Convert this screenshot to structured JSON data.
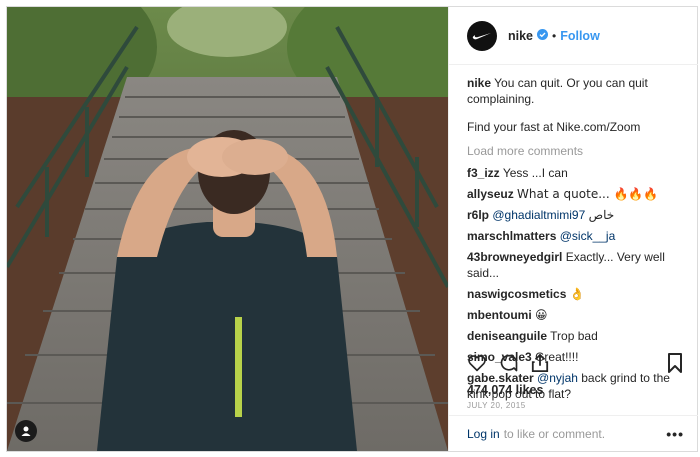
{
  "post": {
    "username": "nike",
    "follow_label": "Follow",
    "dot": "•",
    "caption_user": "nike",
    "caption_text": "You can quit. Or you can quit complaining.",
    "caption_extra": "Find your fast at Nike.com/Zoom",
    "load_more": "Load more comments",
    "comments": [
      {
        "user": "f3_izz",
        "text": "Yess ...I can",
        "mention": ""
      },
      {
        "user": "allyseuz",
        "text": "What a quote... 🔥🔥🔥",
        "mention": ""
      },
      {
        "user": "r6lp",
        "mention": "@ghadialtmimi97",
        "text": " خاص"
      },
      {
        "user": "marschlmatters",
        "mention": "@sick__ja",
        "text": ""
      },
      {
        "user": "43browneyedgirl",
        "text": "Exactly... Very well said...",
        "mention": ""
      },
      {
        "user": "naswigcosmetics",
        "text": "👌",
        "mention": ""
      },
      {
        "user": "mbentoumi",
        "text": "😀",
        "mention": ""
      },
      {
        "user": "deniseanguile",
        "text": "Trop bad",
        "mention": ""
      },
      {
        "user": "simo_vale3",
        "text": "Great!!!!",
        "mention": ""
      },
      {
        "user": "gabe.skater",
        "mention": "@nyjah",
        "text": " back grind to the kink pop out to flat?"
      }
    ],
    "likes": "474,074 likes",
    "date": "JULY 20, 2015",
    "login_label": "Log in",
    "login_suffix": "to like or comment.",
    "more_label": "•••"
  },
  "icons": {
    "avatar": "nike-swoosh-icon",
    "verified": "verified-badge-icon",
    "like": "heart-icon",
    "comment": "comment-bubble-icon",
    "share": "share-icon",
    "save": "bookmark-icon",
    "user_tag": "user-tag-icon"
  },
  "colors": {
    "link": "#3897f0",
    "mention": "#003569",
    "muted": "#999999",
    "text": "#262626"
  }
}
